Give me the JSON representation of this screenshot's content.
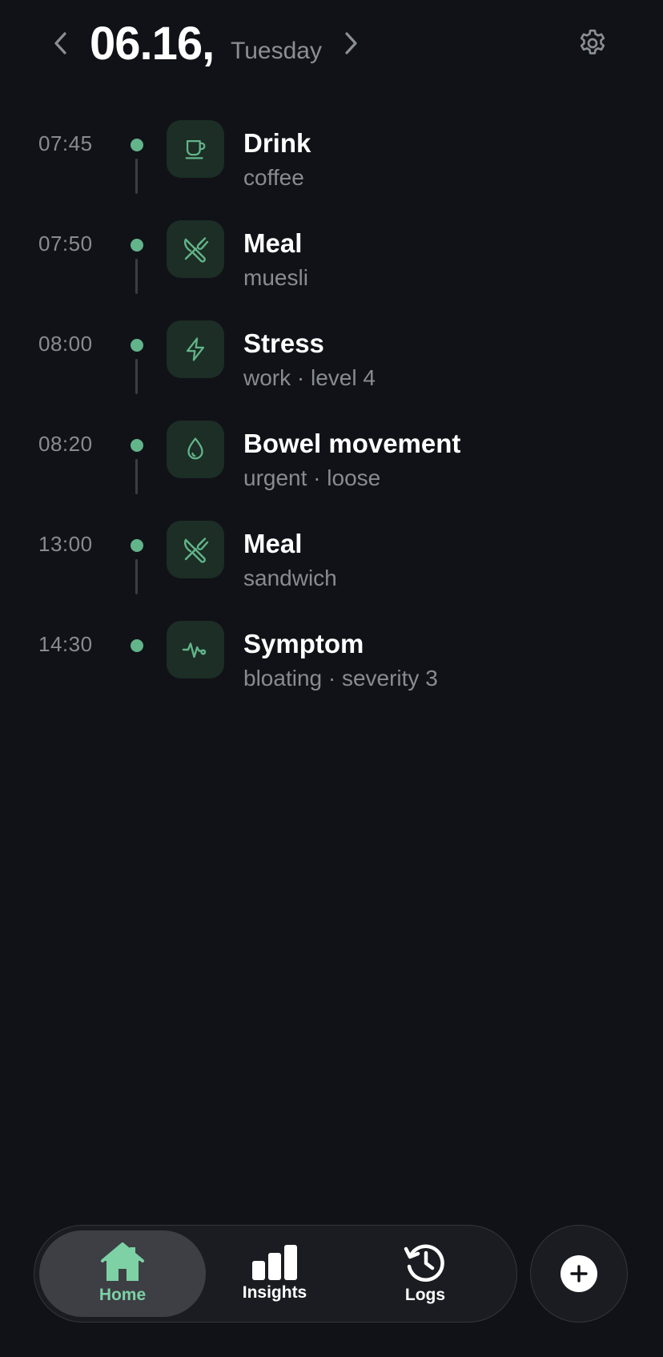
{
  "header": {
    "date": "06.16,",
    "weekday": "Tuesday"
  },
  "colors": {
    "background": "#111217",
    "accent": "#62b48a",
    "icon_bg": "#1c2e25",
    "muted_text": "#878c92"
  },
  "entries": [
    {
      "time": "07:45",
      "title": "Drink",
      "detail": "coffee",
      "icon": "coffee-cup-icon"
    },
    {
      "time": "07:50",
      "title": "Meal",
      "detail": "muesli",
      "icon": "fork-knife-icon"
    },
    {
      "time": "08:00",
      "title": "Stress",
      "detail": "work · level 4",
      "icon": "lightning-icon"
    },
    {
      "time": "08:20",
      "title": "Bowel movement",
      "detail": "urgent · loose",
      "icon": "droplet-icon"
    },
    {
      "time": "13:00",
      "title": "Meal",
      "detail": "sandwich",
      "icon": "fork-knife-icon"
    },
    {
      "time": "14:30",
      "title": "Symptom",
      "detail": "bloating · severity 3",
      "icon": "pulse-icon"
    }
  ],
  "nav": {
    "home": "Home",
    "insights": "Insights",
    "logs": "Logs"
  }
}
